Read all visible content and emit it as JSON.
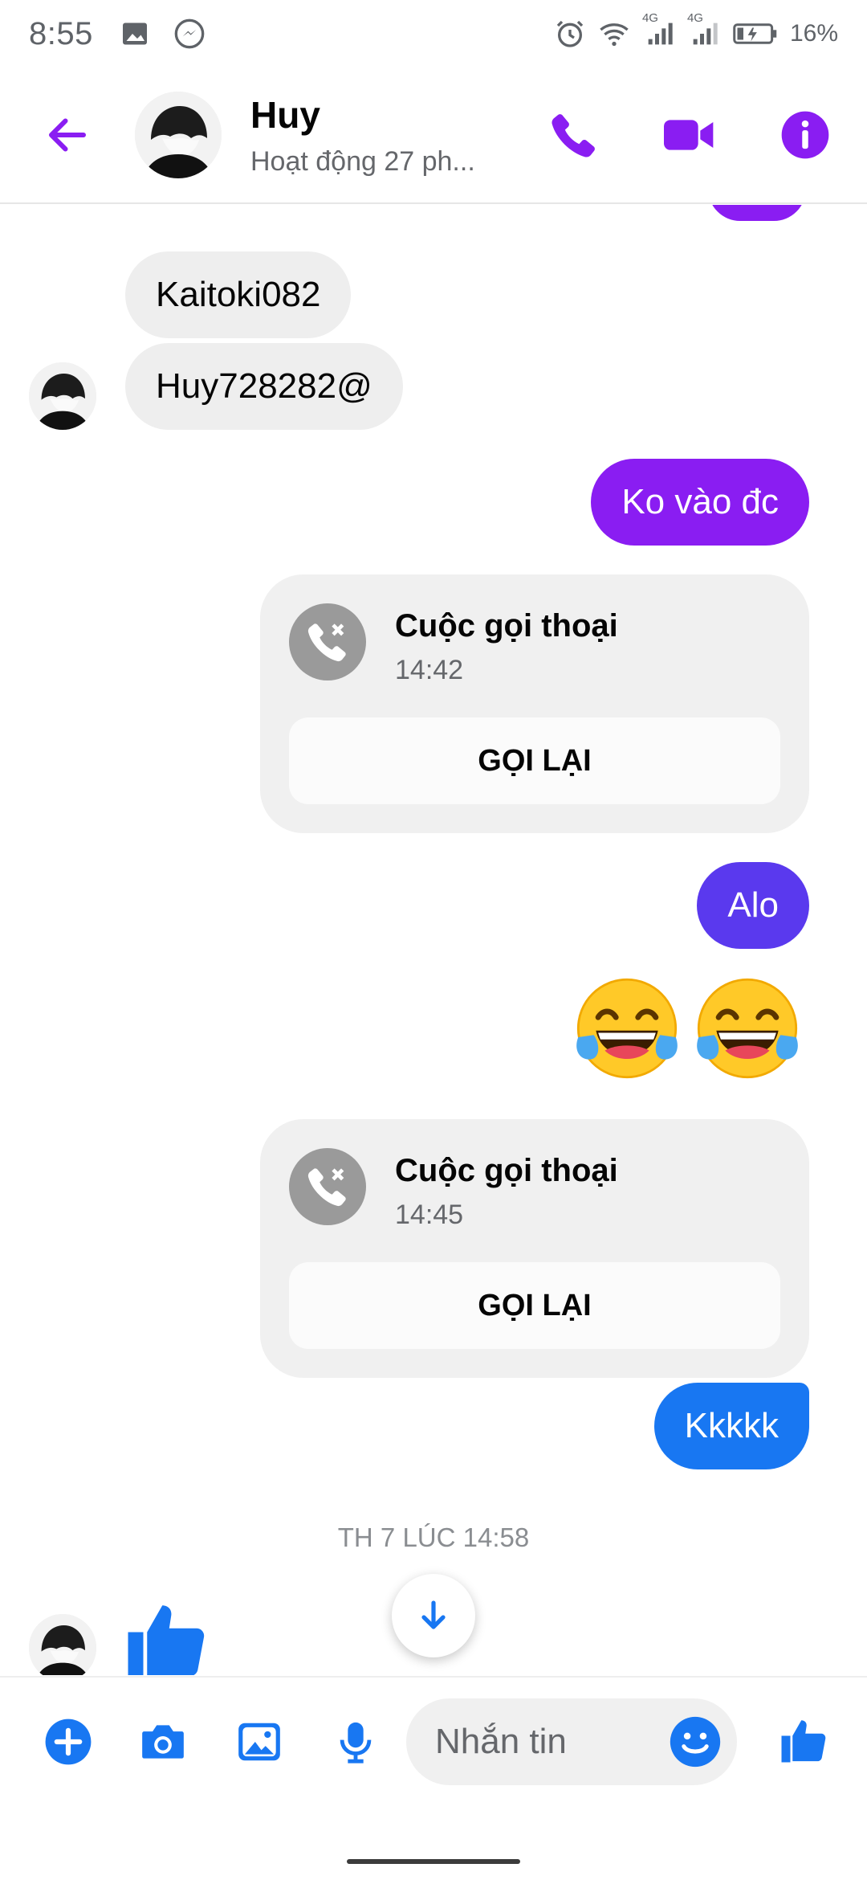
{
  "status_bar": {
    "time": "8:55",
    "battery": "16%",
    "network_a": "4G",
    "network_b": "4G"
  },
  "header": {
    "name": "Huy",
    "status": "Hoạt động 27 ph...",
    "accent": "#8a1df2"
  },
  "messages": {
    "in_1": "Kaitoki082",
    "in_2": "Huy728282@",
    "out_1": "Ko vào đc",
    "call_1": {
      "title": "Cuộc gọi thoại",
      "time": "14:42",
      "action": "GỌI LẠI"
    },
    "out_2": "Alo",
    "emoji": "😂😂",
    "call_2": {
      "title": "Cuộc gọi thoại",
      "time": "14:45",
      "action": "GỌI LẠI"
    },
    "out_3": "Kkkkk",
    "date_separator": "TH 7 LÚC 14:58"
  },
  "composer": {
    "placeholder": "Nhắn tin",
    "icon_color": "#1877f2"
  }
}
